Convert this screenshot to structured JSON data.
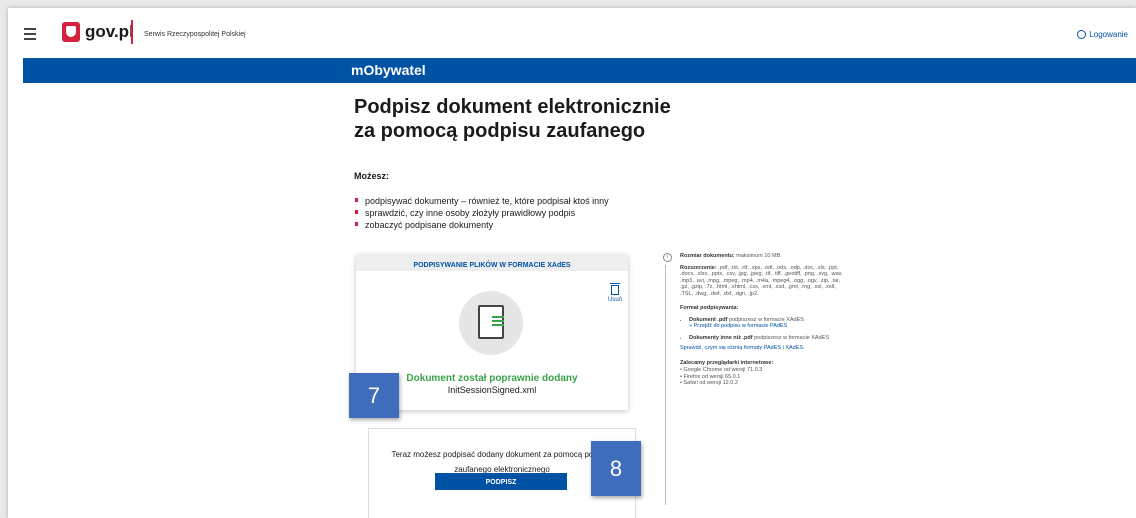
{
  "header": {
    "logo_text": "gov.pl",
    "serwis": "Serwis Rzeczypospolitej Polskiej",
    "login": "Logowanie"
  },
  "band": {
    "title": "mObywatel"
  },
  "main": {
    "title_line1": "Podpisz dokument elektronicznie",
    "title_line2": "za pomocą podpisu zaufanego",
    "mozesz": "Możesz:",
    "bullets": [
      "podpisywać dokumenty – również te, które podpisał ktoś inny",
      "sprawdzić, czy inne osoby złożyły prawidłowy podpis",
      "zobaczyć podpisane dokumenty"
    ]
  },
  "card": {
    "header": "PODPISYWANIE PLIKÓW W FORMACIE XAdES",
    "delete_label": "Usuń",
    "success": "Dokument został poprawnie dodany",
    "filename": "InitSessionSigned.xml"
  },
  "sign_box": {
    "text": "Teraz możesz podpisać dodany dokument za pomocą podpisu zaufanego elektronicznego",
    "button": "PODPISZ"
  },
  "badges": {
    "b7": "7",
    "b8": "8"
  },
  "side": {
    "size_label": "Rozmiar dokumentu:",
    "size_value": "maksimum 10 MB.",
    "ext_label": "Rozszerzenie:",
    "ext_value": ".pdf, .txt, .rtf, .xps, .odt, .ods, .odp, .doc, .xls, .ppt, .docx, .xlsx, .pptx, .csv, .jpg, .jpeg, .tif, .tiff, .geotiff, .png, .svg, .wav, .mp3, .avi, .mpg, .mpeg, .mp4, .m4a, .mpeg4, .ogg, .ogv, .zip, .tar, .gz, .gzip, .7z, .html, .xhtml, .css, .xml, .xsd, .gml, .rng, .xsl, .xslt, .TSL, .dwg, .dwf, .dxf, .dgn, .jp2.",
    "format_title": "Format podpisywania:",
    "pdf_label": "Dokument .pdf",
    "pdf_value": "podpiszesz w formacie XAdES",
    "pades_link": "» Przejdź do podpisu w formacie PAdES",
    "other_label": "Dokumenty inne niż .pdf",
    "other_value": "podpiszesz w formacie XAdES",
    "diff_link": "Sprawdź, czym się różnią formaty PAdES i XAdES.",
    "browsers_title": "Zalecamy przeglądarki internetowe:",
    "browsers": [
      "Google Chrome od wersji 71.0.3",
      "Firefox od wersji 65.0.1",
      "Safari od wersji 12.0.2"
    ]
  }
}
